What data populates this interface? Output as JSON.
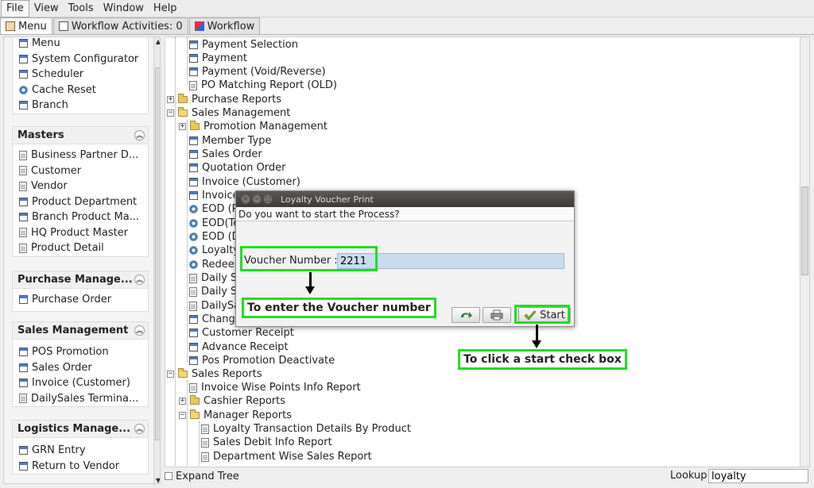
{
  "menu": [
    "File",
    "View",
    "Tools",
    "Window",
    "Help"
  ],
  "tabs": [
    {
      "label": "Menu",
      "icon": "home-icon"
    },
    {
      "label": "Workflow Activities: 0",
      "icon": "window-icon"
    },
    {
      "label": "Workflow",
      "icon": "workflow-icon"
    }
  ],
  "left": {
    "top_items": [
      "Menu",
      "System Configurator",
      "Scheduler",
      "Cache Reset",
      "Branch"
    ],
    "groups": [
      {
        "title": "Masters",
        "items": [
          "Business Partner D...",
          "Customer",
          "Vendor",
          "Product Department",
          "Branch Product Ma...",
          "HQ Product Master",
          "Product Detail"
        ]
      },
      {
        "title": "Purchase Manage...",
        "items": [
          "Purchase Order"
        ]
      },
      {
        "title": "Sales Management",
        "items": [
          "POS Promotion",
          "Sales Order",
          "Invoice (Customer)",
          "DailySales Termina..."
        ]
      },
      {
        "title": "Logistics Manage...",
        "items": [
          "GRN Entry",
          "Return to Vendor"
        ]
      }
    ]
  },
  "tree": [
    "Payment Selection",
    "Payment",
    "Payment (Void/Reverse)",
    "PO Matching Report (OLD)",
    "Purchase Reports",
    "Sales Management",
    "Promotion Management",
    "Member Type",
    "Sales Order",
    "Quotation Order",
    "Invoice (Customer)",
    "Invoice",
    "EOD (P",
    "EOD(Te",
    "EOD (D",
    "Loyalty",
    "Redeem",
    "Daily S",
    "Daily S",
    "DailySa",
    "Change",
    "Customer Receipt",
    "Advance Receipt",
    "Pos Promotion Deactivate",
    "Sales Reports",
    "Invoice Wise Points Info Report",
    "Cashier Reports",
    "Manager Reports",
    "Loyalty Transaction Details By Product",
    "Sales Debit Info Report",
    "Department Wise Sales Report"
  ],
  "bottom": {
    "expand_label": "Expand Tree",
    "lookup_label": "Lookup",
    "lookup_value": "loyalty"
  },
  "dialog": {
    "title": "Loyalty Voucher Print",
    "question": "Do you want to start the Process?",
    "voucher_label": "Voucher Number :",
    "voucher_value": "2211",
    "start_label": "Start"
  },
  "annotations": {
    "enter_voucher": "To enter the Voucher number",
    "click_start": "To click a start check box"
  },
  "colors": {
    "highlight": "#22dd22",
    "accent": "#4a7cc9"
  }
}
